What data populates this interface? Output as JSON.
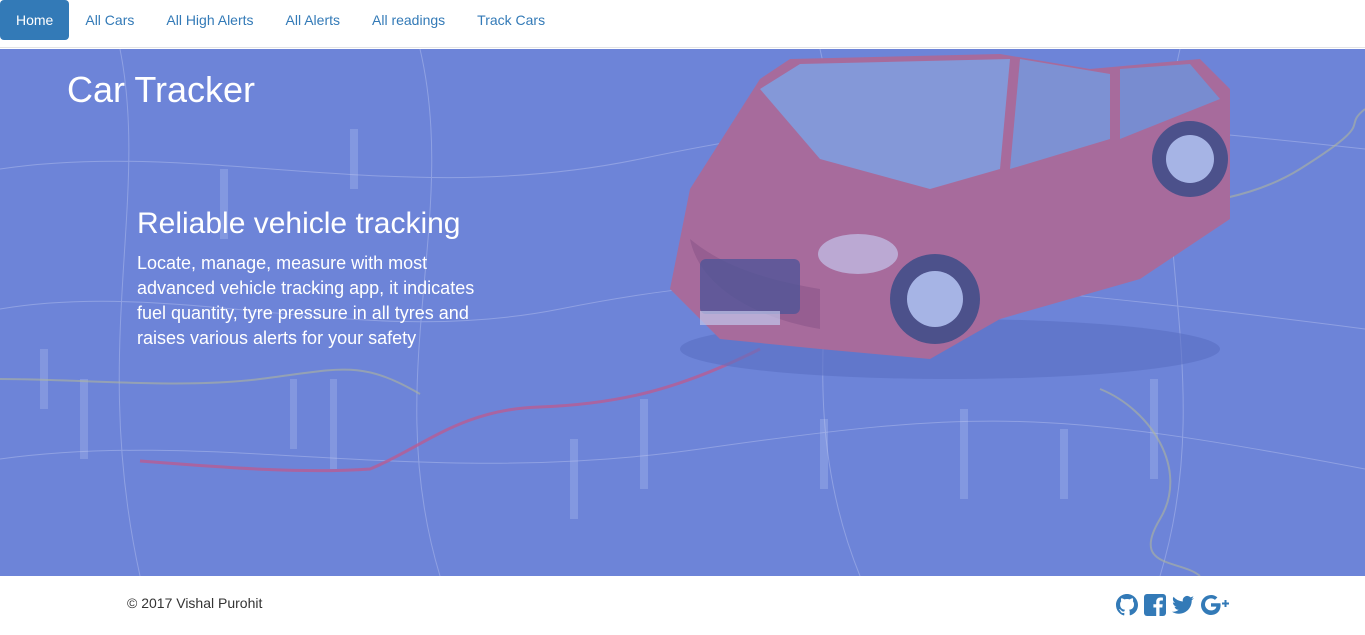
{
  "nav": {
    "items": [
      {
        "label": "Home",
        "active": true
      },
      {
        "label": "All Cars"
      },
      {
        "label": "All High Alerts"
      },
      {
        "label": "All Alerts"
      },
      {
        "label": "All readings"
      },
      {
        "label": "Track Cars"
      }
    ]
  },
  "hero": {
    "title": "Car Tracker",
    "heading": "Reliable vehicle tracking",
    "text": "Locate, manage, measure with most advanced vehicle tracking app, it indicates fuel quantity, tyre pressure in all tyres and raises various alerts for your safety"
  },
  "footer": {
    "copyright": "© 2017 Vishal Purohit",
    "social": [
      "github-icon",
      "facebook-icon",
      "twitter-icon",
      "google-plus-icon"
    ]
  },
  "colors": {
    "accent": "#337ab7",
    "hero_overlay": "#5b72d6",
    "social_icon": "#337ab7"
  }
}
